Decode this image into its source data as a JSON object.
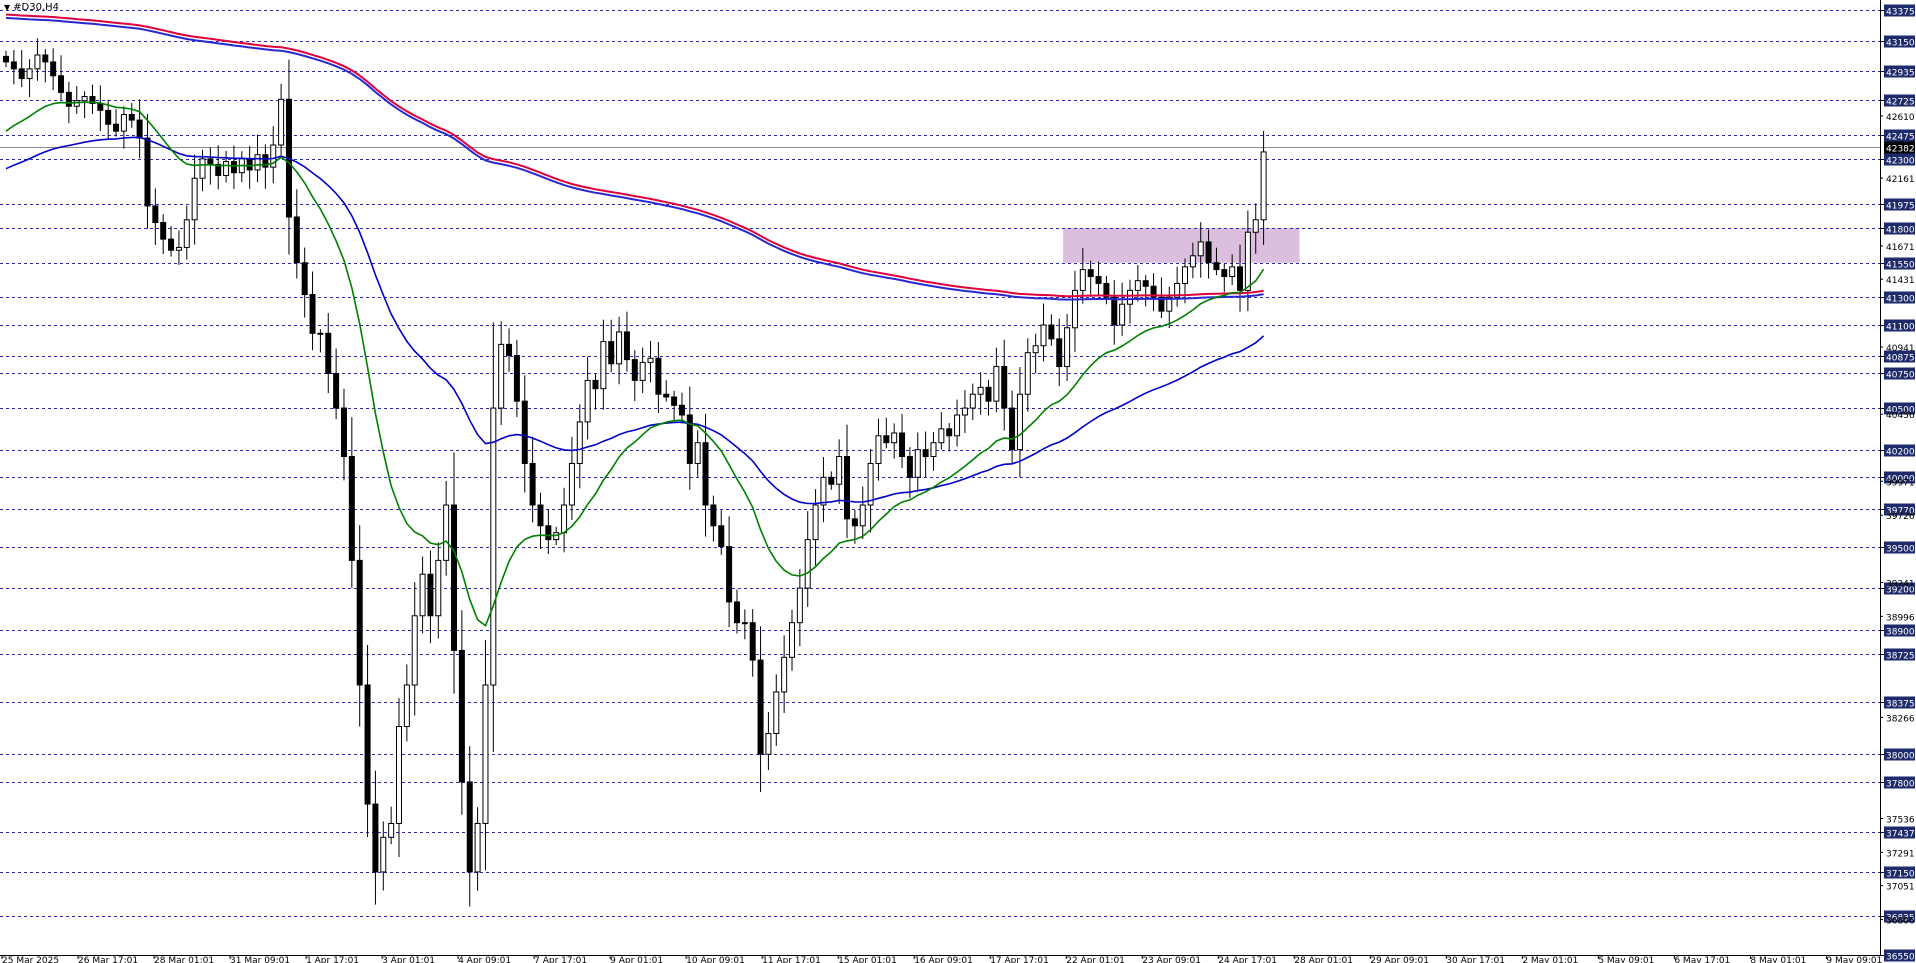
{
  "header": {
    "symbol_label": "#D30,H4"
  },
  "colors": {
    "bull_candle": "#ffffff",
    "bear_candle": "#000000",
    "ema21": "#008000",
    "ema55": "#0000c8",
    "envelope_upper": "#e0003c",
    "envelope_lower": "#2828d0",
    "zone": "#d8b8dc",
    "grid": "#2a2aaa",
    "price_tag_bg": "#1e2a6a"
  },
  "chart_data": {
    "type": "candlestick",
    "title": "",
    "symbol": "#D30",
    "timeframe": "H4",
    "ylim": [
      36550,
      43375
    ],
    "grid_levels": [
      43375,
      43150,
      42935,
      42725,
      42475,
      42300,
      41975,
      41800,
      41550,
      41300,
      41100,
      40875,
      40750,
      40500,
      40200,
      40000,
      39770,
      39500,
      39200,
      38900,
      38725,
      38375,
      38000,
      37800,
      37437,
      37150,
      36835,
      36550
    ],
    "minor_ticks": [
      42610,
      42161,
      41671,
      41431,
      40941,
      40456,
      39971,
      39726,
      39241,
      38996,
      38266,
      37536,
      37291,
      37051,
      36806
    ],
    "current_price": 42382,
    "x_tick_labels": [
      "25 Mar 2025",
      "26 Mar 17:01",
      "28 Mar 01:01",
      "31 Mar 09:01",
      "1 Apr 17:01",
      "3 Apr 01:01",
      "4 Apr 09:01",
      "7 Apr 17:01",
      "9 Apr 01:01",
      "10 Apr 09:01",
      "11 Apr 17:01",
      "15 Apr 01:01",
      "16 Apr 09:01",
      "17 Apr 17:01",
      "22 Apr 01:01",
      "23 Apr 09:01",
      "24 Apr 17:01",
      "28 Apr 01:01",
      "29 Apr 09:01",
      "30 Apr 17:01",
      "2 May 01:01",
      "5 May 09:01",
      "6 May 17:01",
      "8 May 01:01",
      "9 May 09:01"
    ],
    "closes": [
      43000,
      42950,
      42880,
      42950,
      43050,
      43000,
      42900,
      42780,
      42680,
      42720,
      42750,
      42700,
      42650,
      42550,
      42500,
      42620,
      42580,
      42450,
      41960,
      41840,
      41720,
      41640,
      41660,
      41860,
      42160,
      42300,
      42260,
      42180,
      42280,
      42200,
      42300,
      42220,
      42330,
      42240,
      42400,
      42730,
      41880,
      41550,
      41320,
      41040,
      41040,
      40750,
      40500,
      40150,
      39400,
      38500,
      37640,
      37150,
      37400,
      37500,
      38200,
      38500,
      39000,
      39300,
      39000,
      39400,
      39800,
      38750,
      37800,
      37150,
      37500,
      38500,
      40500,
      40960,
      40880,
      40550,
      40100,
      39800,
      39650,
      39550,
      39600,
      39800,
      40100,
      40400,
      40700,
      40640,
      40980,
      40820,
      41050,
      40850,
      40700,
      40830,
      40860,
      40600,
      40580,
      40520,
      40450,
      40100,
      40250,
      39800,
      39650,
      39500,
      39100,
      38950,
      38950,
      38680,
      38000,
      38150,
      38450,
      38700,
      38950,
      39200,
      39550,
      39800,
      40000,
      39950,
      40150,
      39700,
      39650,
      39800,
      40100,
      40300,
      40250,
      40320,
      40150,
      40000,
      40200,
      40150,
      40250,
      40350,
      40300,
      40450,
      40500,
      40600,
      40650,
      40550,
      40800,
      40500,
      40200,
      40600,
      40900,
      40950,
      41100,
      41000,
      40800,
      41080,
      41350,
      41500,
      41450,
      41400,
      41300,
      41100,
      41250,
      41350,
      41420,
      41380,
      41300,
      41200,
      41300,
      41400,
      41520,
      41600,
      41700,
      41550,
      41500,
      41450,
      41520,
      41350,
      41770,
      41860,
      42350
    ]
  }
}
